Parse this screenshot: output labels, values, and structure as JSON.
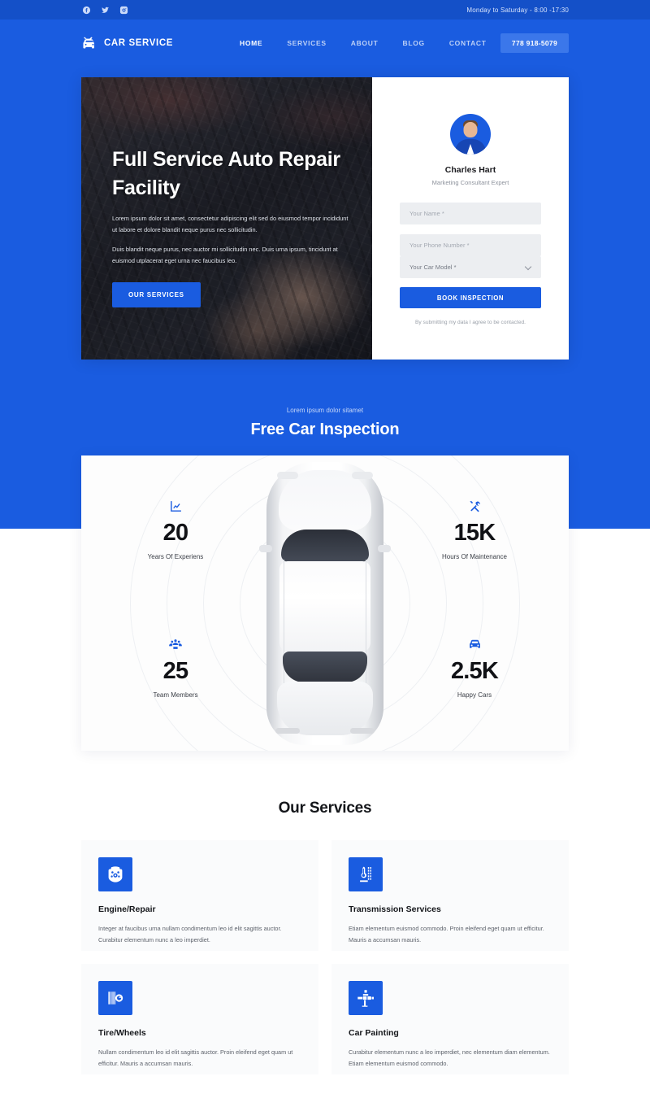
{
  "topbar": {
    "hours": "Monday to Saturday - 8:00 -17:30",
    "socials": [
      {
        "name": "facebook-icon",
        "label": "Facebook"
      },
      {
        "name": "twitter-icon",
        "label": "Twitter"
      },
      {
        "name": "instagram-icon",
        "label": "Instagram"
      }
    ]
  },
  "nav": {
    "brand": "CAR SERVICE",
    "links": [
      {
        "label": "HOME",
        "active": true
      },
      {
        "label": "SERVICES",
        "active": false
      },
      {
        "label": "ABOUT",
        "active": false
      },
      {
        "label": "BLOG",
        "active": false
      },
      {
        "label": "CONTACT",
        "active": false
      }
    ],
    "phone": "778 918-5079"
  },
  "hero": {
    "title": "Full Service Auto Repair Facility",
    "paragraph1": "Lorem ipsum dolor sit amet, consectetur adipiscing elit sed do eiusmod tempor incididunt ut labore et dolore blandit neque purus nec sollicitudin.",
    "paragraph2": "Duis blandit neque purus, nec auctor mi sollicitudin nec. Duis urna ipsum, tincidunt at euismod utplacerat eget urna nec faucibus leo.",
    "cta": "OUR SERVICES"
  },
  "form": {
    "person_name": "Charles Hart",
    "person_role": "Marketing Consultant Expert",
    "name_placeholder": "Your Name *",
    "phone_placeholder": "Your Phone Number *",
    "car_model_value": "Your Car Model *",
    "car_model_options": [
      "Your Car Model *"
    ],
    "submit_label": "BOOK INSPECTION",
    "consent": "By submitting my data I agree to be contacted."
  },
  "inspection": {
    "eyebrow": "Lorem ipsum dolor sitamet",
    "title": "Free Car Inspection",
    "stats": [
      {
        "icon": "chart-line-icon",
        "value": "20",
        "label": "Years Of Experiens"
      },
      {
        "icon": "tools-icon",
        "value": "15K",
        "label": "Hours Of Maintenance"
      },
      {
        "icon": "people-group-icon",
        "value": "25",
        "label": "Team Members"
      },
      {
        "icon": "car-icon",
        "value": "2.5K",
        "label": "Happy Cars"
      }
    ]
  },
  "services": {
    "title": "Our Services",
    "cards": [
      {
        "icon": "engine-icon",
        "name": "Engine/Repair",
        "desc": "Integer at faucibus urna nullam condimentum leo id elit sagittis auctor. Curabitur elementum nunc a leo imperdiet."
      },
      {
        "icon": "gearshift-icon",
        "name": "Transmission Services",
        "desc": "Etiam elementum euismod commodo. Proin eleifend eget quam ut efficitur. Mauris a accumsan mauris."
      },
      {
        "icon": "tire-icon",
        "name": "Tire/Wheels",
        "desc": "Nullam condimentum leo id elit sagittis auctor. Proin eleifend eget quam ut efficitur. Mauris a accumsan mauris."
      },
      {
        "icon": "spray-gun-icon",
        "name": "Car Painting",
        "desc": "Curabitur elementum nunc a leo imperdiet, nec elementum diam elementum. Etiam elementum euismod commodo."
      }
    ]
  },
  "colors": {
    "brand_blue": "#1a5ce0",
    "topbar_blue": "#1450c8",
    "phone_btn_blue": "#3b77ea",
    "card_bg": "#fafbfc",
    "field_bg": "#eceef1"
  }
}
